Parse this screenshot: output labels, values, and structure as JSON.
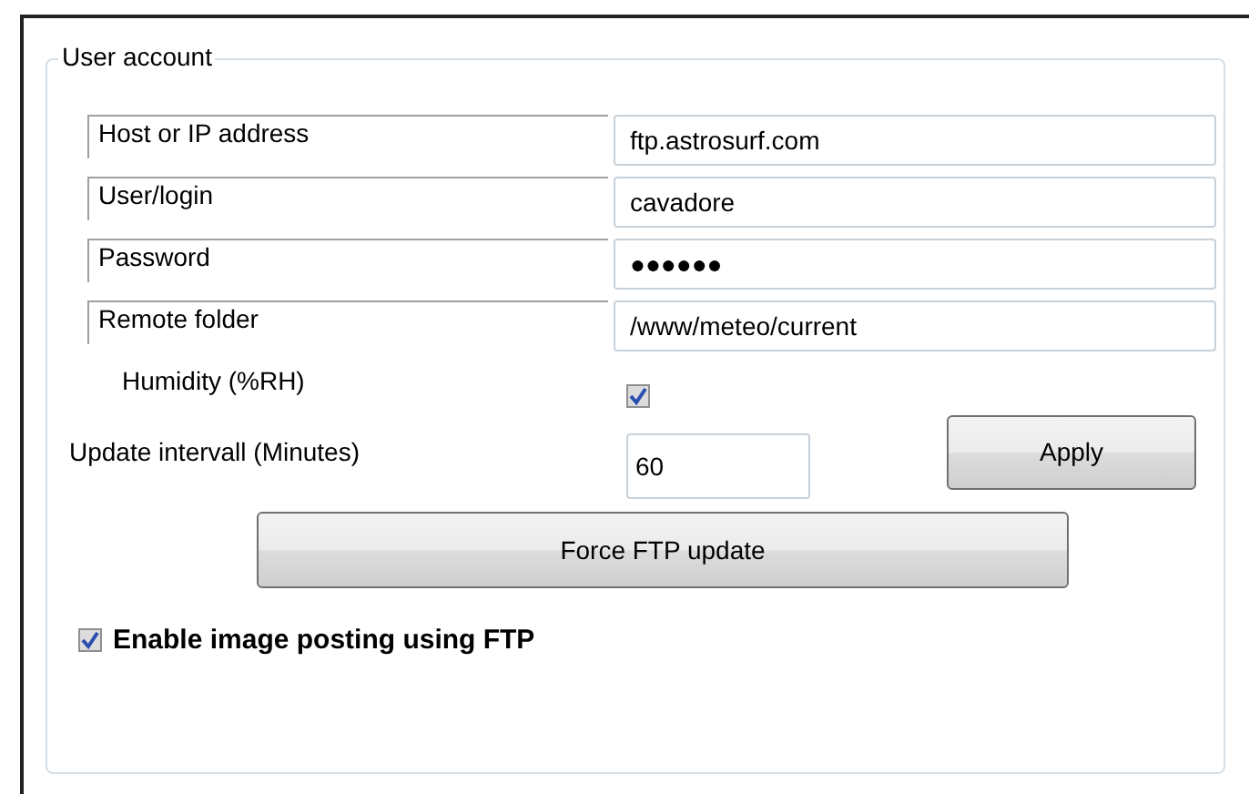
{
  "group": {
    "title": "User account"
  },
  "fields": [
    {
      "label": "Host or IP address",
      "value": "ftp.astrosurf.com"
    },
    {
      "label": "User/login",
      "value": "cavadore"
    },
    {
      "label": "Password",
      "value": "●●●●●●"
    },
    {
      "label": "Remote folder",
      "value": "/www/meteo/current"
    }
  ],
  "humidity": {
    "label": "Humidity (%RH)",
    "checked": true
  },
  "interval": {
    "label": "Update intervall (Minutes)",
    "value": "60"
  },
  "buttons": {
    "apply": "Apply",
    "force": "Force FTP update"
  },
  "image_posting": {
    "label": "Enable image posting using FTP",
    "checked": true
  }
}
